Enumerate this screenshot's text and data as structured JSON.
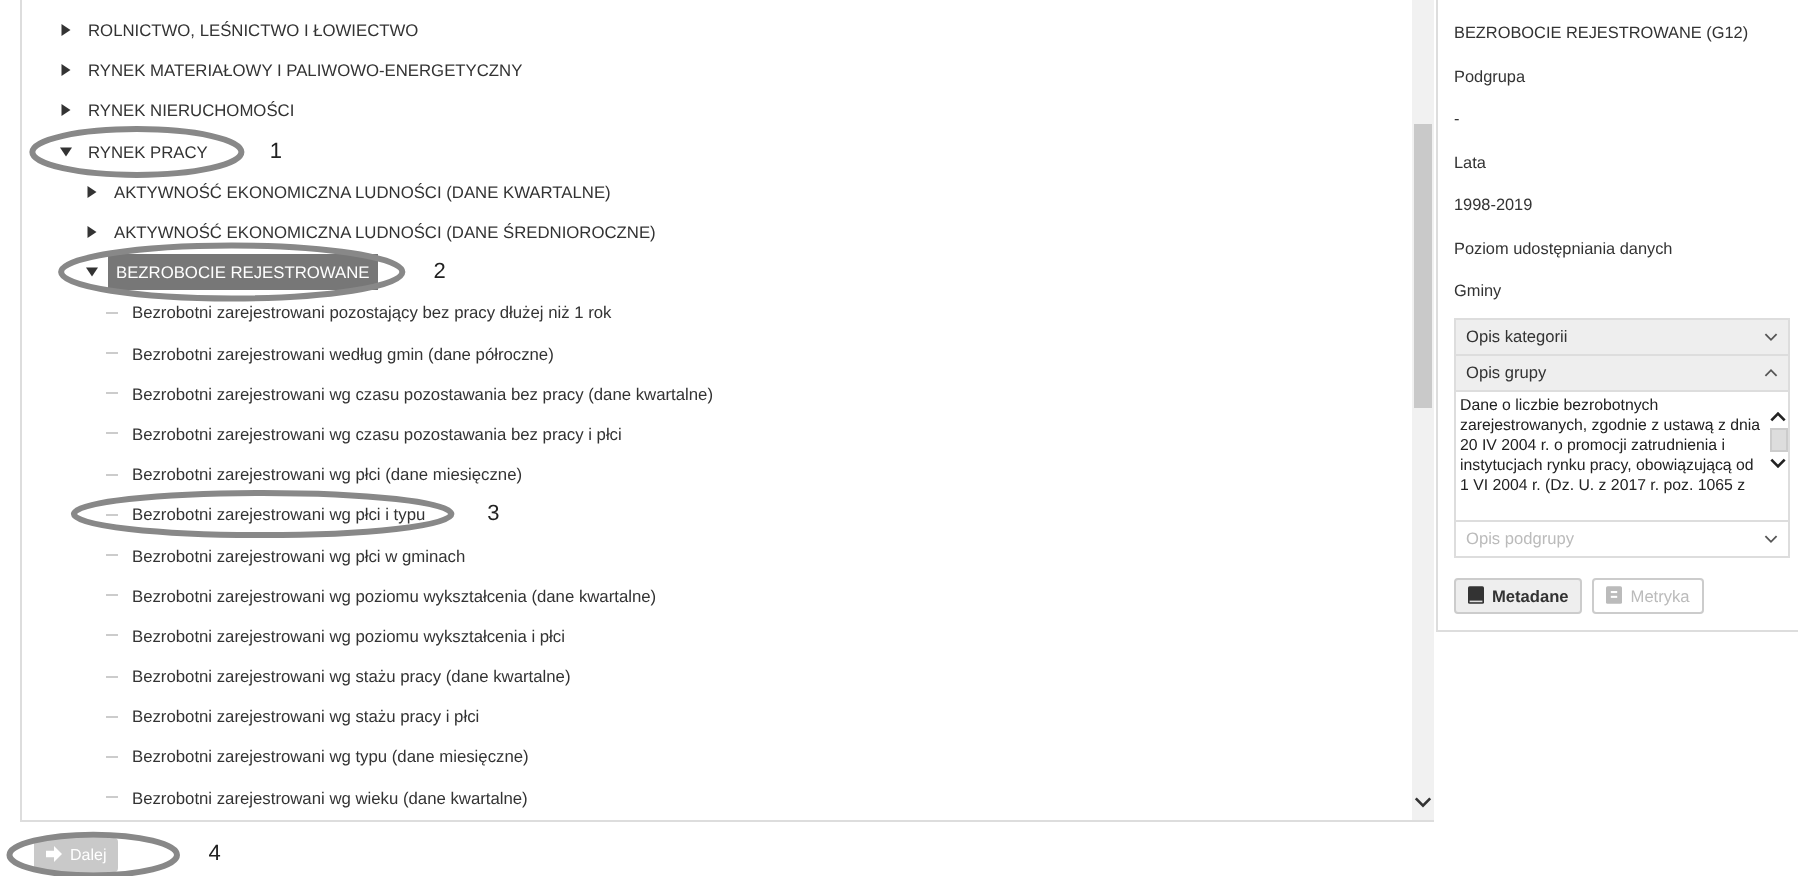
{
  "tree": [
    {
      "label": "ROLNICTWO, LEŚNICTWO I ŁOWIECTWO",
      "expanded": false,
      "selected": false
    },
    {
      "label": "RYNEK MATERIAŁOWY I PALIWOWO-ENERGETYCZNY",
      "expanded": false,
      "selected": false
    },
    {
      "label": "RYNEK NIERUCHOMOŚCI",
      "expanded": false,
      "selected": false
    },
    {
      "label": "RYNEK PRACY",
      "expanded": true,
      "selected": false,
      "annotation": "1",
      "children": [
        {
          "label": "AKTYWNOŚĆ EKONOMICZNA LUDNOŚCI (DANE KWARTALNE)",
          "expanded": false,
          "selected": false
        },
        {
          "label": "AKTYWNOŚĆ EKONOMICZNA LUDNOŚCI (DANE ŚREDNIOROCZNE)",
          "expanded": false,
          "selected": false
        },
        {
          "label": "BEZROBOCIE REJESTROWANE",
          "expanded": true,
          "selected": true,
          "annotation": "2",
          "children": [
            {
              "label": "Bezrobotni zarejestrowani pozostający bez pracy dłużej niż 1 rok",
              "selected": false
            },
            {
              "label": "Bezrobotni zarejestrowani według gmin (dane półroczne)",
              "selected": false
            },
            {
              "label": "Bezrobotni zarejestrowani wg czasu pozostawania bez pracy (dane kwartalne)",
              "selected": false
            },
            {
              "label": "Bezrobotni zarejestrowani wg czasu pozostawania bez pracy i płci",
              "selected": false
            },
            {
              "label": "Bezrobotni zarejestrowani wg płci (dane miesięczne)",
              "selected": false
            },
            {
              "label": "Bezrobotni zarejestrowani wg płci i typu",
              "selected": false,
              "annotation": "3"
            },
            {
              "label": "Bezrobotni zarejestrowani wg płci w gminach",
              "selected": false
            },
            {
              "label": "Bezrobotni zarejestrowani wg poziomu wykształcenia (dane kwartalne)",
              "selected": false
            },
            {
              "label": "Bezrobotni zarejestrowani wg poziomu wykształcenia i płci",
              "selected": false
            },
            {
              "label": "Bezrobotni zarejestrowani wg stażu pracy (dane kwartalne)",
              "selected": false
            },
            {
              "label": "Bezrobotni zarejestrowani wg stażu pracy i płci",
              "selected": false
            },
            {
              "label": "Bezrobotni zarejestrowani wg typu (dane miesięczne)",
              "selected": false
            },
            {
              "label": "Bezrobotni zarejestrowani wg wieku (dane kwartalne)",
              "selected": false
            }
          ]
        }
      ]
    }
  ],
  "next_button": {
    "label": "Dalej",
    "disabled": true,
    "annotation": "4"
  },
  "details": {
    "title": "BEZROBOCIE REJESTROWANE (G12)",
    "fields": [
      {
        "label": "Podgrupa",
        "value": "-"
      },
      {
        "label": "Lata",
        "value": "1998-2019"
      },
      {
        "label": "Poziom udostępniania danych",
        "value": "Gminy"
      }
    ],
    "sections": [
      {
        "title": "Opis kategorii",
        "expanded": false,
        "disabled": false
      },
      {
        "title": "Opis grupy",
        "expanded": true,
        "disabled": false,
        "text": "Dane o liczbie bezrobotnych zarejestrowanych, zgodnie z ustawą z dnia 20 IV 2004 r. o promocji zatrudnienia i instytucjach rynku pracy, obowiązującą od 1 VI 2004 r. (Dz. U. z 2017 r. poz. 1065 z"
      },
      {
        "title": "Opis podgrupy",
        "expanded": false,
        "disabled": true
      }
    ],
    "buttons": [
      {
        "label": "Metadane",
        "disabled": false
      },
      {
        "label": "Metryka",
        "disabled": true
      }
    ]
  }
}
